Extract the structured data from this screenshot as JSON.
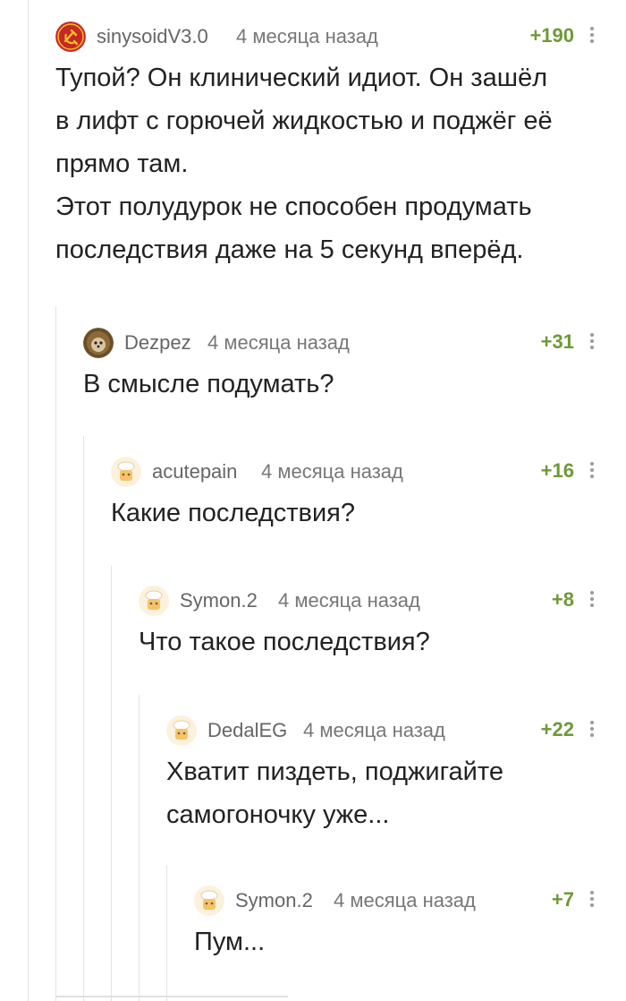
{
  "comments": [
    {
      "username": "sinysoidV3.0",
      "time": "4 месяца назад",
      "rating": "+190",
      "avatar_icon": "hammer-sickle-icon",
      "lines": [
        "Тупой? Он клинический идиот. Он зашёл",
        "в лифт с горючей жидкостью и поджёг её",
        "прямо там.",
        "Этот полудурок не способен продумать",
        "последствия даже на 5 секунд вперёд."
      ]
    },
    {
      "username": "Dezpez",
      "time": "4 месяца назад",
      "rating": "+31",
      "avatar_icon": "hedgehog-avatar-icon",
      "lines": [
        "В смысле подумать?"
      ]
    },
    {
      "username": "acutepain",
      "time": "4 месяца назад",
      "rating": "+16",
      "avatar_icon": "default-chef-avatar-icon",
      "lines": [
        "Какие последствия?"
      ]
    },
    {
      "username": "Symon.2",
      "time": "4 месяца назад",
      "rating": "+8",
      "avatar_icon": "default-chef-avatar-icon",
      "lines": [
        "Что такое последствия?"
      ]
    },
    {
      "username": "DedalEG",
      "time": "4 месяца назад",
      "rating": "+22",
      "avatar_icon": "default-chef-avatar-icon",
      "lines": [
        "Хватит пиздеть, поджигайте",
        "самогоночку уже..."
      ]
    },
    {
      "username": "Symon.2",
      "time": "4 месяца назад",
      "rating": "+7",
      "avatar_icon": "default-chef-avatar-icon",
      "lines": [
        "Пум..."
      ]
    }
  ],
  "colors": {
    "rating": "#6c9a36",
    "username": "#666666",
    "thread_line": "#e3e3e3"
  }
}
